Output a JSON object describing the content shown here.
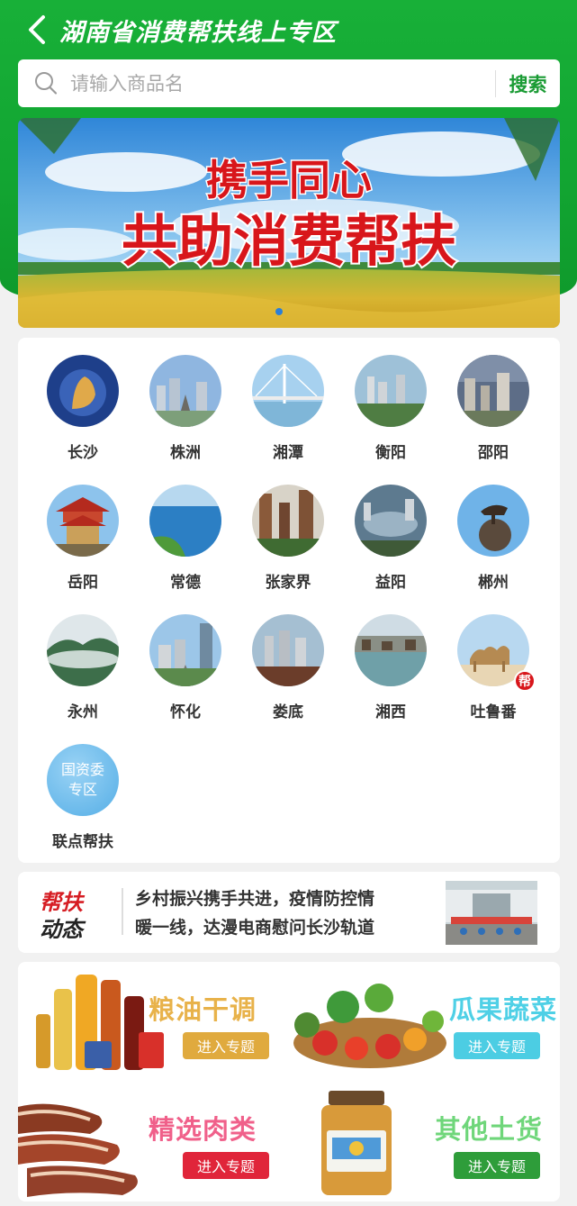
{
  "header": {
    "title": "湖南省消费帮扶线上专区",
    "back_label": ""
  },
  "search": {
    "placeholder": "请输入商品名",
    "button_label": "搜索",
    "value": ""
  },
  "banner": {
    "line1": "携手同心",
    "line2": "共助消费帮扶"
  },
  "cities": [
    {
      "label": "长沙"
    },
    {
      "label": "株洲"
    },
    {
      "label": "湘潭"
    },
    {
      "label": "衡阳"
    },
    {
      "label": "邵阳"
    },
    {
      "label": "岳阳"
    },
    {
      "label": "常德"
    },
    {
      "label": "张家界"
    },
    {
      "label": "益阳"
    },
    {
      "label": "郴州"
    },
    {
      "label": "永州"
    },
    {
      "label": "怀化"
    },
    {
      "label": "娄底"
    },
    {
      "label": "湘西"
    },
    {
      "label": "吐鲁番",
      "badge": "帮"
    },
    {
      "label": "联点帮扶",
      "circle_text_1": "国资委",
      "circle_text_2": "专区"
    }
  ],
  "news": {
    "tag_line1": "帮扶",
    "tag_line2": "动态",
    "headline_line1": "乡村振兴携手共进，疫情防控情",
    "headline_line2": "暖一线，达漫电商慰问长沙轨道"
  },
  "categories": [
    {
      "name": "粮油干调",
      "button": "进入专题",
      "color": "#e8b24a",
      "btn_color": "#e0aa3e"
    },
    {
      "name": "瓜果蔬菜",
      "button": "进入专题",
      "color": "#4fd0e6",
      "btn_color": "#4ccde3"
    },
    {
      "name": "精选肉类",
      "button": "进入专题",
      "color": "#f0608a",
      "btn_color": "#e0253a"
    },
    {
      "name": "其他土货",
      "button": "进入专题",
      "color": "#6fd67a",
      "btn_color": "#2e9d3a"
    }
  ]
}
